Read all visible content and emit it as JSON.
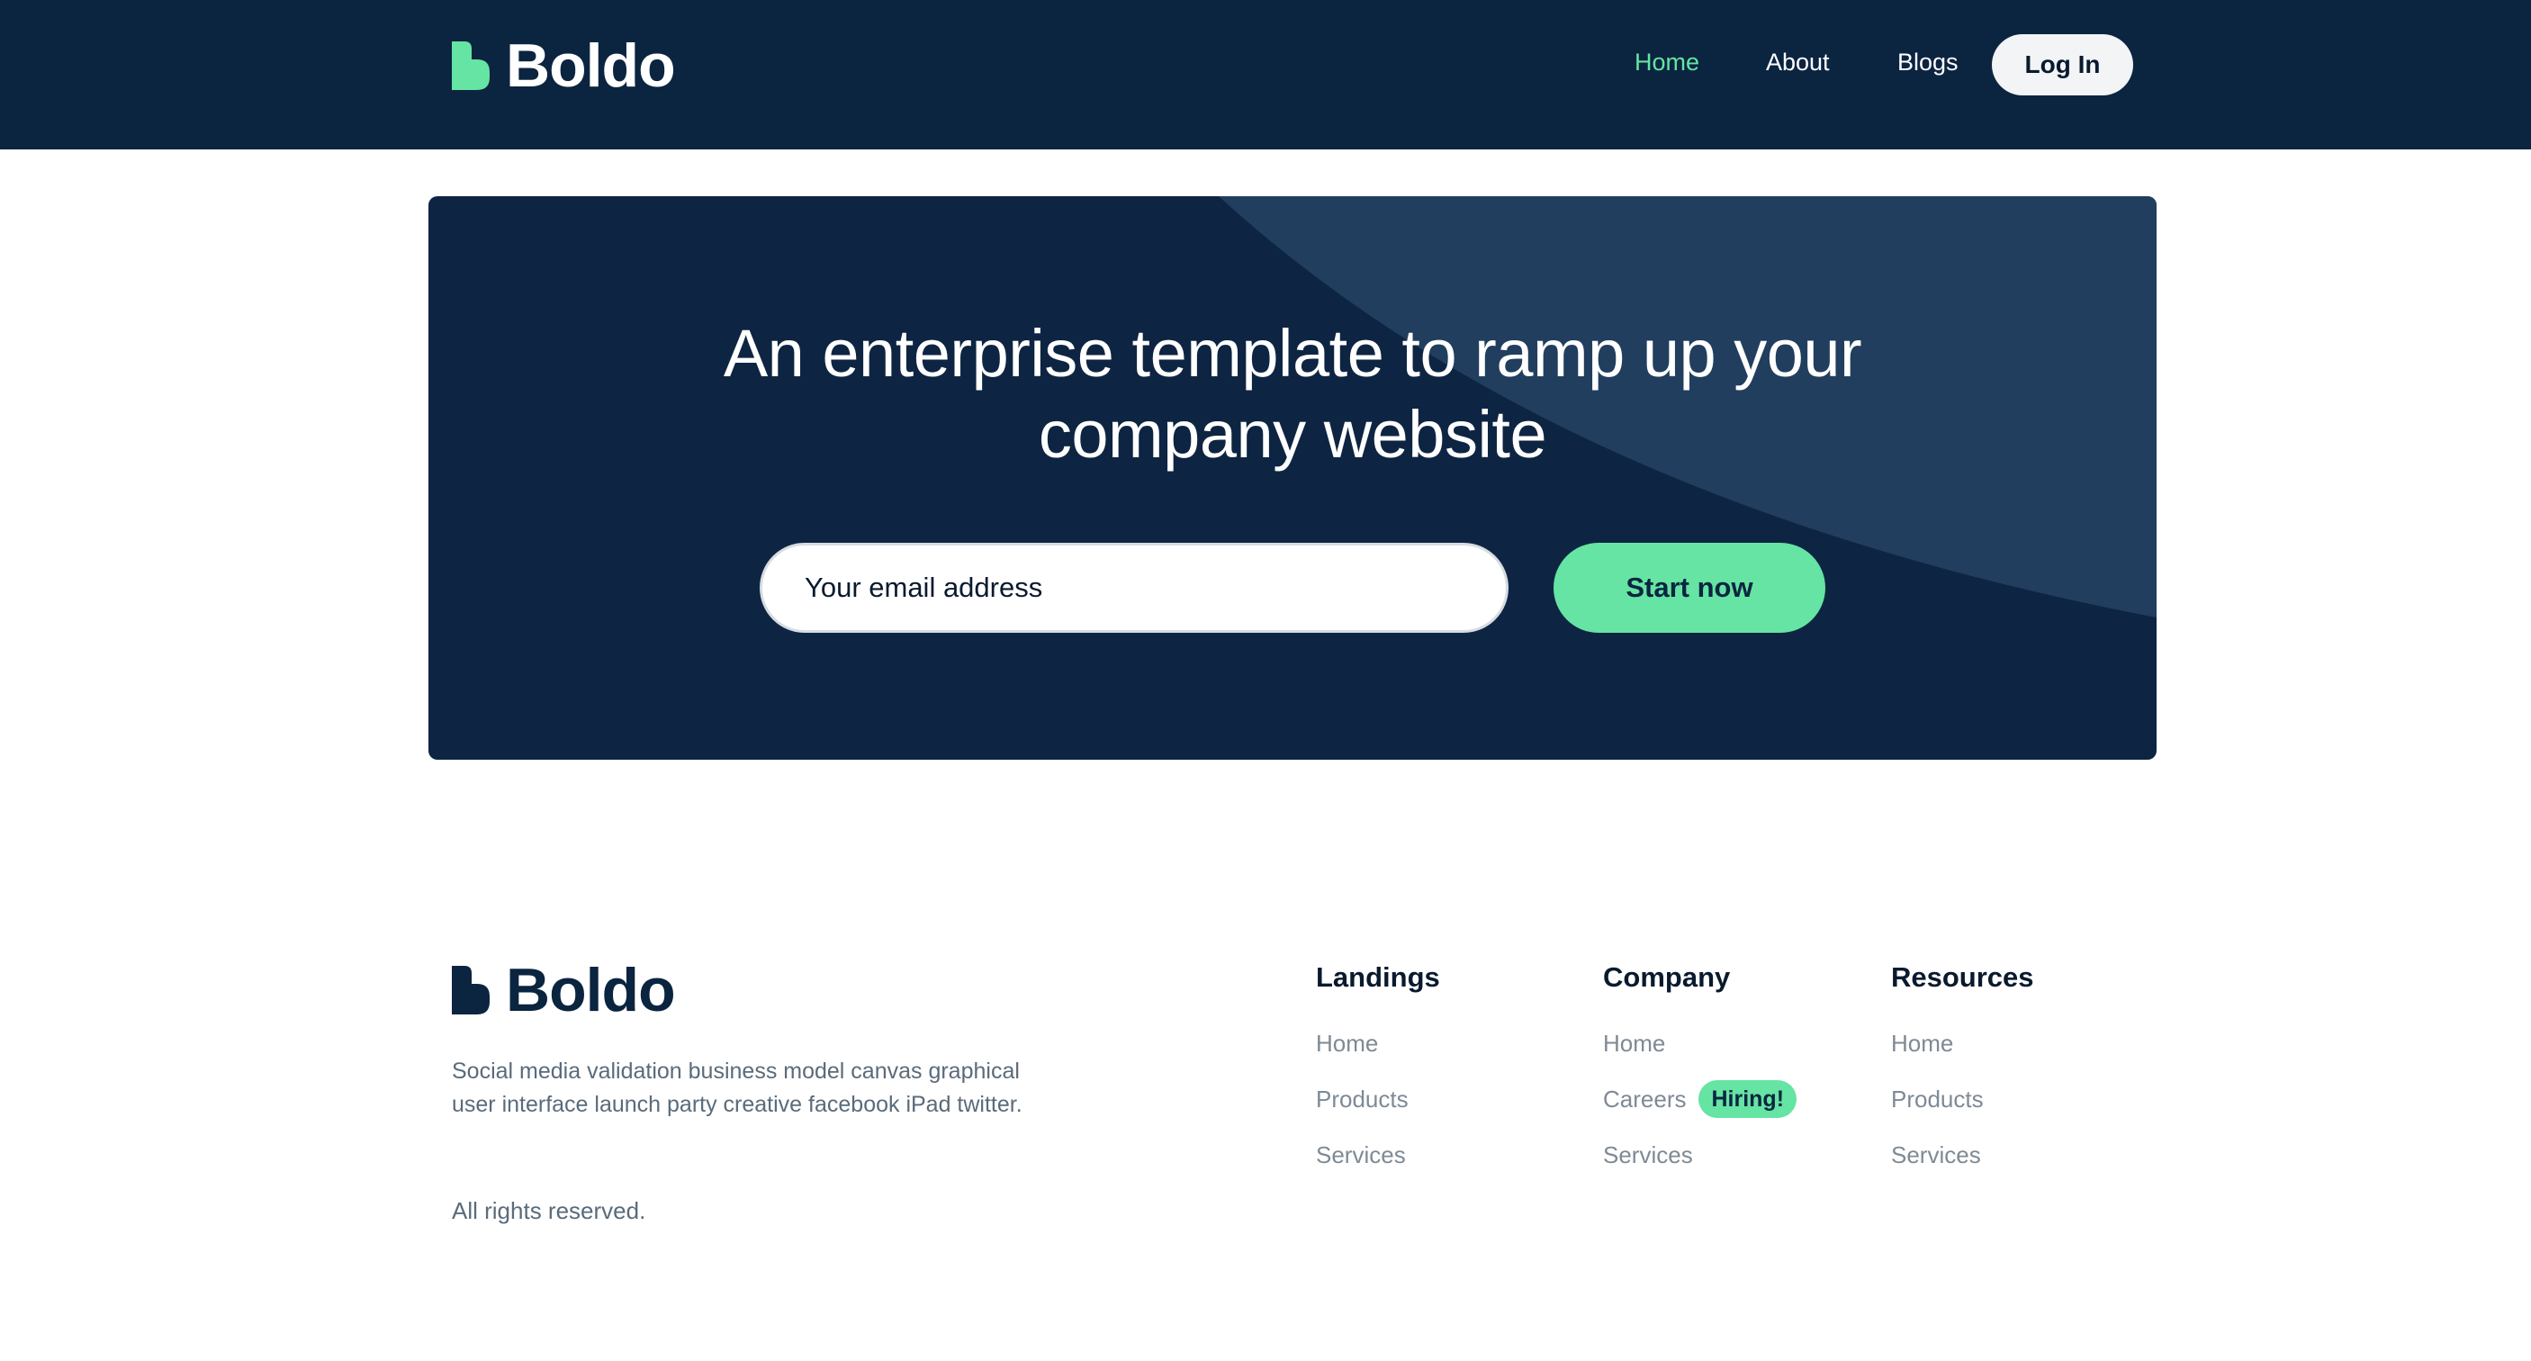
{
  "brand": {
    "name": "Boldo",
    "accent_color": "#65E4A3",
    "dark_color": "#0B2440"
  },
  "nav": {
    "items": [
      {
        "label": "Home",
        "active": true
      },
      {
        "label": "About",
        "active": false
      },
      {
        "label": "Blogs",
        "active": false
      }
    ],
    "login_label": "Log In"
  },
  "hero": {
    "title_line1": "An enterprise template to ramp up your",
    "title_line2": "company website",
    "email_placeholder": "Your email address",
    "cta_label": "Start now"
  },
  "footer": {
    "description_line1": "Social media validation business model canvas graphical",
    "description_line2": "user interface launch party creative facebook iPad twitter.",
    "rights": "All rights reserved.",
    "columns": [
      {
        "title": "Landings",
        "links": [
          {
            "label": "Home"
          },
          {
            "label": "Products"
          },
          {
            "label": "Services"
          }
        ]
      },
      {
        "title": "Company",
        "links": [
          {
            "label": "Home"
          },
          {
            "label": "Careers",
            "badge": "Hiring!"
          },
          {
            "label": "Services"
          }
        ]
      },
      {
        "title": "Resources",
        "links": [
          {
            "label": "Home"
          },
          {
            "label": "Products"
          },
          {
            "label": "Services"
          }
        ]
      }
    ]
  }
}
